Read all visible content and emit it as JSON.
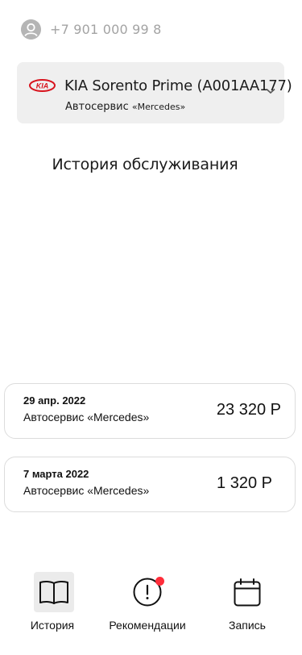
{
  "profile": {
    "phone": "+7 901 000 99 8"
  },
  "car": {
    "brand_logo_text": "KIA",
    "name": "KIA Sorento Prime (A001AA177)",
    "service_prefix": "Автосервис",
    "service_name": "«Mercedes»"
  },
  "section": {
    "title": "История обслуживания"
  },
  "history": [
    {
      "date": "29 апр. 2022",
      "place": "Автосервис «Mercedes»",
      "amount": "23 320 Р"
    },
    {
      "date": "7 марта 2022",
      "place": "Автосервис «Mercedes»",
      "amount": "1 320 Р"
    }
  ],
  "tabs": [
    {
      "label": "История",
      "icon": "book-icon",
      "active": true
    },
    {
      "label": "Рекомендации",
      "icon": "alert-circle-icon",
      "active": false,
      "badge": true
    },
    {
      "label": "Запись",
      "icon": "calendar-icon",
      "active": false
    }
  ],
  "colors": {
    "card_bg": "#efefef",
    "brand_red": "#d8141e",
    "badge_red": "#ff2d3a",
    "phone_text": "#a3a3a3"
  }
}
